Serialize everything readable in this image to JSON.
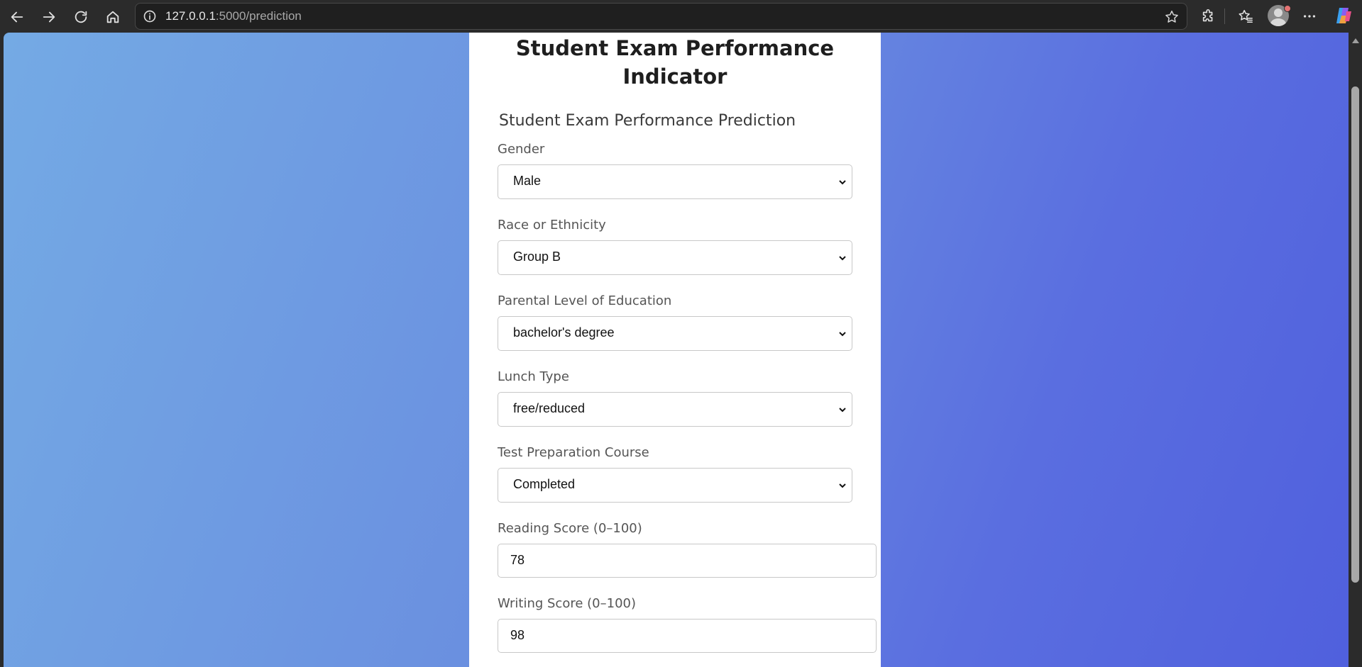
{
  "browser": {
    "url_host": "127.0.0.1",
    "url_path": ":5000/prediction",
    "icons": {
      "back": "back-arrow-icon",
      "forward": "forward-arrow-icon",
      "reload": "reload-icon",
      "home": "home-icon",
      "site_info": "info-icon",
      "favorite": "star-icon",
      "extensions": "puzzle-icon",
      "favorites": "favorites-icon",
      "profile": "avatar-icon",
      "more": "more-icon",
      "copilot": "copilot-icon"
    }
  },
  "page": {
    "title": "Student Exam Performance Indicator",
    "subtitle": "Student Exam Performance Prediction",
    "fields": {
      "gender": {
        "label": "Gender",
        "value": "Male"
      },
      "race": {
        "label": "Race or Ethnicity",
        "value": "Group B"
      },
      "parental_education": {
        "label": "Parental Level of Education",
        "value": "bachelor's degree"
      },
      "lunch": {
        "label": "Lunch Type",
        "value": "free/reduced"
      },
      "test_prep": {
        "label": "Test Preparation Course",
        "value": "Completed"
      },
      "reading_score": {
        "label": "Reading Score (0–100)",
        "value": "78"
      },
      "writing_score": {
        "label": "Writing Score (0–100)",
        "value": "98"
      }
    }
  },
  "colors": {
    "gradient_start": "#74aae4",
    "gradient_end": "#5060dd",
    "card": "#ffffff",
    "chrome": "#2b2b2b"
  }
}
